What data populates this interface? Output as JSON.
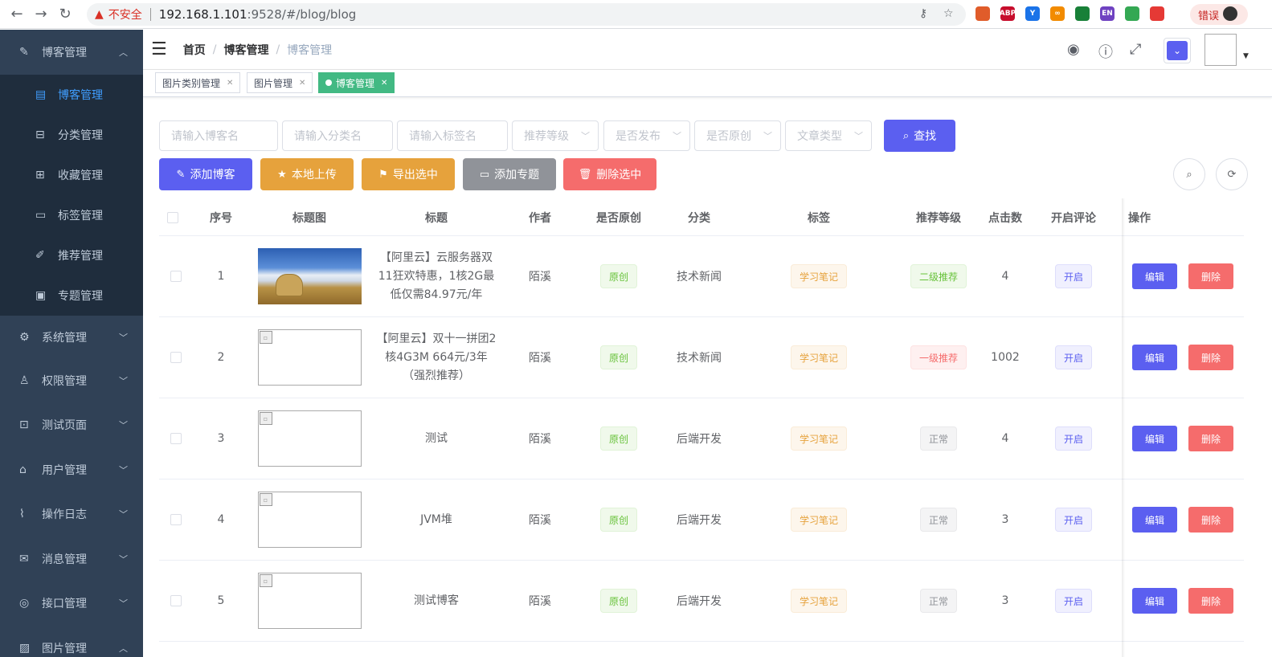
{
  "browser": {
    "insecure_label": "不安全",
    "url_host": "192.168.1.101",
    "url_rest": ":9528/#/blog/blog",
    "error_label": "错误",
    "extensions": [
      {
        "name": "sitemap-ext-icon",
        "label": "",
        "color": "#e05c2a"
      },
      {
        "name": "adblock-ext-icon",
        "label": "ABP",
        "color": "#c70d2c"
      },
      {
        "name": "y-ext-icon",
        "label": "Y",
        "color": "#1a73e8"
      },
      {
        "name": "infinity-ext-icon",
        "label": "∞",
        "color": "#f28b00"
      },
      {
        "name": "puzzle-ext-icon",
        "label": "",
        "color": "#188038"
      },
      {
        "name": "en-ext-icon",
        "label": "EN",
        "color": "#6f42c1"
      },
      {
        "name": "color-ext-icon",
        "label": "",
        "color": "#34a853"
      },
      {
        "name": "dice-ext-icon",
        "label": "",
        "color": "#e53935"
      }
    ]
  },
  "sidebar": {
    "blog_group": "博客管理",
    "sub_items": [
      {
        "label": "博客管理",
        "icon": "document-icon",
        "active": true
      },
      {
        "label": "分类管理",
        "icon": "category-icon",
        "active": false
      },
      {
        "label": "收藏管理",
        "icon": "folder-download-icon",
        "active": false
      },
      {
        "label": "标签管理",
        "icon": "folder-icon",
        "active": false
      },
      {
        "label": "推荐管理",
        "icon": "pen-icon",
        "active": false
      },
      {
        "label": "专题管理",
        "icon": "save-icon",
        "active": false
      }
    ],
    "groups": [
      {
        "label": "系统管理",
        "icon": "gear-icon"
      },
      {
        "label": "权限管理",
        "icon": "user-icon"
      },
      {
        "label": "测试页面",
        "icon": "chip-icon"
      },
      {
        "label": "用户管理",
        "icon": "home-icon"
      },
      {
        "label": "操作日志",
        "icon": "attachment-icon"
      },
      {
        "label": "消息管理",
        "icon": "message-icon"
      },
      {
        "label": "接口管理",
        "icon": "compass-icon"
      },
      {
        "label": "图片管理",
        "icon": "picture-icon"
      }
    ]
  },
  "header": {
    "breadcrumb": [
      "首页",
      "博客管理",
      "博客管理"
    ]
  },
  "tags": [
    {
      "label": "图片类别管理",
      "active": false
    },
    {
      "label": "图片管理",
      "active": false
    },
    {
      "label": "博客管理",
      "active": true
    }
  ],
  "filters": {
    "blog_name_placeholder": "请输入博客名",
    "category_placeholder": "请输入分类名",
    "tag_placeholder": "请输入标签名",
    "level_placeholder": "推荐等级",
    "publish_placeholder": "是否发布",
    "original_placeholder": "是否原创",
    "type_placeholder": "文章类型",
    "search_label": "查找"
  },
  "actions": {
    "add_blog": "添加博客",
    "local_upload": "本地上传",
    "export_selected": "导出选中",
    "add_topic": "添加专题",
    "delete_selected": "删除选中"
  },
  "table": {
    "headers": [
      "序号",
      "标题图",
      "标题",
      "作者",
      "是否原创",
      "分类",
      "标签",
      "推荐等级",
      "点击数",
      "开启评论",
      "操作"
    ],
    "edit_label": "编辑",
    "delete_label": "删除",
    "rows": [
      {
        "index": "1",
        "title": "【阿里云】云服务器双11狂欢特惠，1核2G最低仅需84.97元/年",
        "author": "陌溪",
        "original": "原创",
        "category": "技术新闻",
        "tag": "学习笔记",
        "level": "二级推荐",
        "level_style": "green",
        "clicks": "4",
        "comment": "开启",
        "photo": true
      },
      {
        "index": "2",
        "title": "【阿里云】双十一拼团2核4G3M 664元/3年（强烈推荐）",
        "author": "陌溪",
        "original": "原创",
        "category": "技术新闻",
        "tag": "学习笔记",
        "level": "一级推荐",
        "level_style": "red",
        "clicks": "1002",
        "comment": "开启",
        "photo": false
      },
      {
        "index": "3",
        "title": "测试",
        "author": "陌溪",
        "original": "原创",
        "category": "后端开发",
        "tag": "学习笔记",
        "level": "正常",
        "level_style": "gray",
        "clicks": "4",
        "comment": "开启",
        "photo": false
      },
      {
        "index": "4",
        "title": "JVM堆",
        "author": "陌溪",
        "original": "原创",
        "category": "后端开发",
        "tag": "学习笔记",
        "level": "正常",
        "level_style": "gray",
        "clicks": "3",
        "comment": "开启",
        "photo": false
      },
      {
        "index": "5",
        "title": "测试博客",
        "author": "陌溪",
        "original": "原创",
        "category": "后端开发",
        "tag": "学习笔记",
        "level": "正常",
        "level_style": "gray",
        "clicks": "3",
        "comment": "开启",
        "photo": false
      }
    ]
  },
  "colors": {
    "sidebar_bg": "#304156",
    "sidebar_sub_bg": "#1f2d3d",
    "active_text": "#409eff",
    "primary": "#5b5ff0",
    "warning": "#e6a23c",
    "info": "#909399",
    "danger": "#f56c6c",
    "tag_active": "#42b983"
  }
}
